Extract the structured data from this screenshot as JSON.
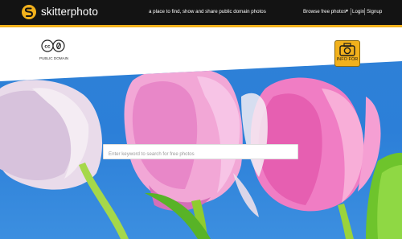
{
  "header": {
    "brand": "skitterphoto",
    "tagline": "a place to find, show and share public domain photos",
    "nav": {
      "browse": "Browse free photos",
      "caret": "▼",
      "login": "Login",
      "signup": "Signup"
    }
  },
  "license": {
    "label": "PUBLIC DOMAIN"
  },
  "info_badge": {
    "label": "INFO FOR"
  },
  "search": {
    "placeholder": "Enter keyword to search for free photos"
  },
  "colors": {
    "accent": "#f2b11c",
    "nav_bg": "#131313",
    "sky": "#2f82d6"
  }
}
